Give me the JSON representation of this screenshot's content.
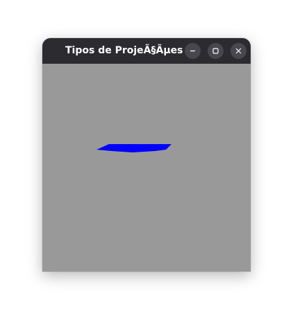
{
  "window": {
    "title": "Tipos de ProjeÃ§Ãµes",
    "buttons": {
      "minimize": "minimize-icon",
      "maximize": "maximize-icon",
      "close": "close-icon"
    }
  },
  "canvas": {
    "background": "#999999",
    "shape_color": "#0000ff"
  }
}
